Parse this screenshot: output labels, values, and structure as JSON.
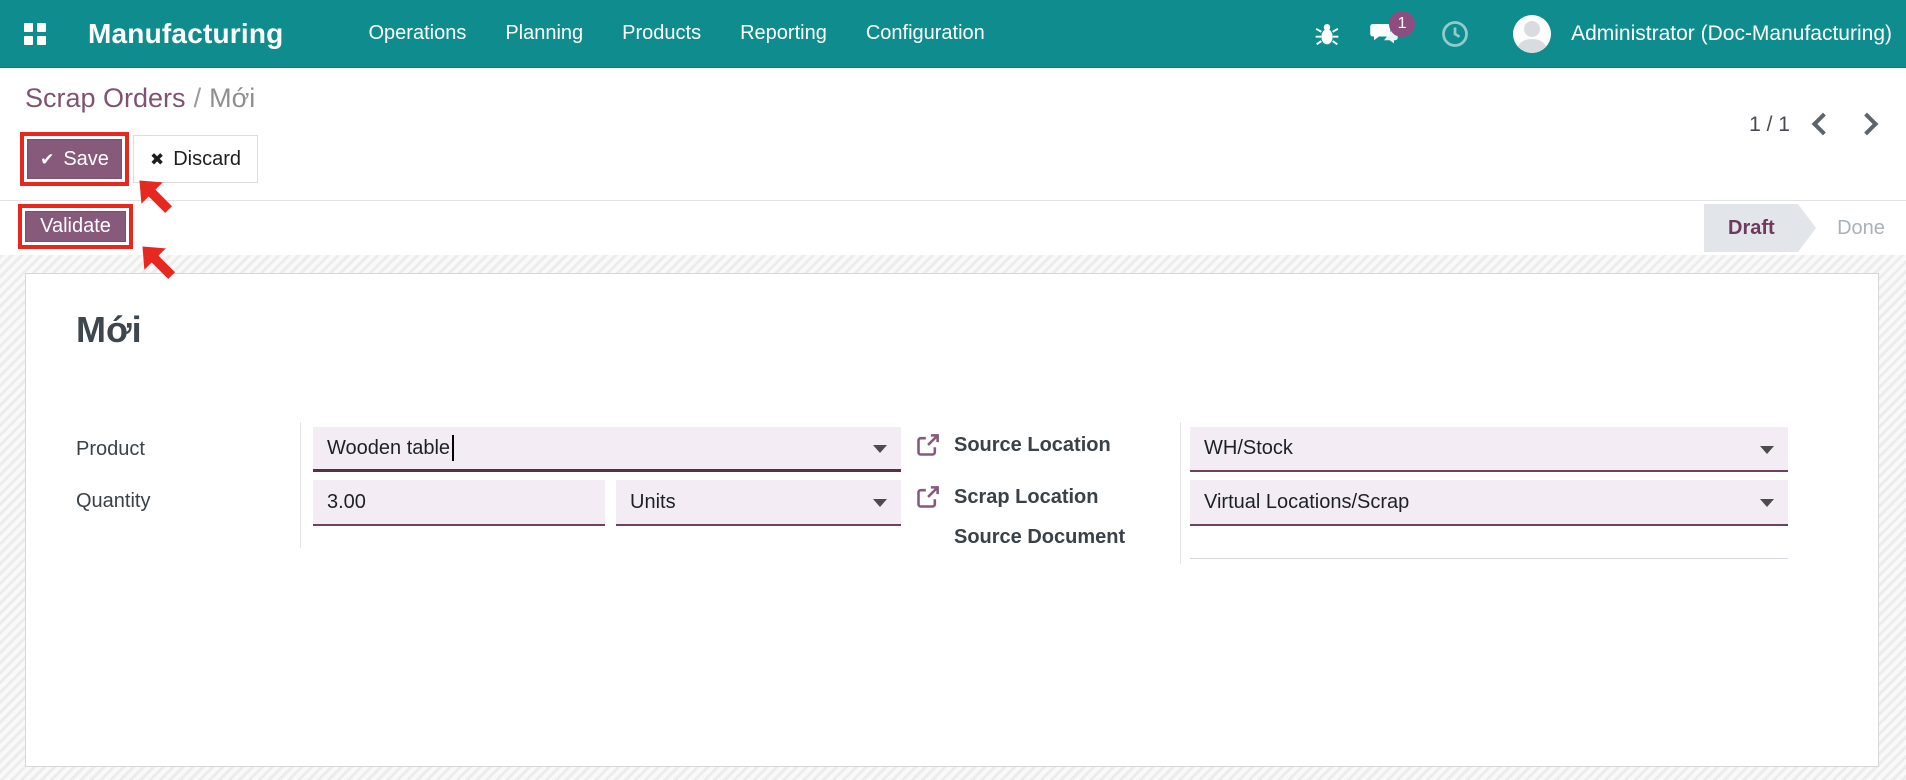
{
  "navbar": {
    "app_name": "Manufacturing",
    "menu_items": [
      "Operations",
      "Planning",
      "Products",
      "Reporting",
      "Configuration"
    ],
    "message_badge": "1",
    "user_name": "Administrator (Doc-Manufacturing)"
  },
  "breadcrumb": {
    "parent": "Scrap Orders",
    "separator": "/",
    "current": "Mới"
  },
  "control_panel": {
    "save_label": "Save",
    "discard_label": "Discard",
    "pager": "1 / 1"
  },
  "form_header": {
    "validate_label": "Validate",
    "statuses": [
      {
        "label": "Draft",
        "active": true
      },
      {
        "label": "Done",
        "active": false
      }
    ]
  },
  "sheet": {
    "title": "Mới",
    "fields": {
      "product": {
        "label": "Product",
        "value": "Wooden table"
      },
      "quantity": {
        "label": "Quantity",
        "value": "3.00",
        "uom": "Units"
      },
      "source_location": {
        "label": "Source Location",
        "value": "WH/Stock"
      },
      "scrap_location": {
        "label": "Scrap Location",
        "value": "Virtual Locations/Scrap"
      },
      "source_document": {
        "label": "Source Document",
        "value": ""
      }
    }
  },
  "colors": {
    "navbar_teal": "#0f8d8e",
    "primary_purple": "#875A7B",
    "annotation_red": "#e6281f",
    "field_background": "#f3ecf4",
    "status_active_bg": "#e2e5e9"
  }
}
